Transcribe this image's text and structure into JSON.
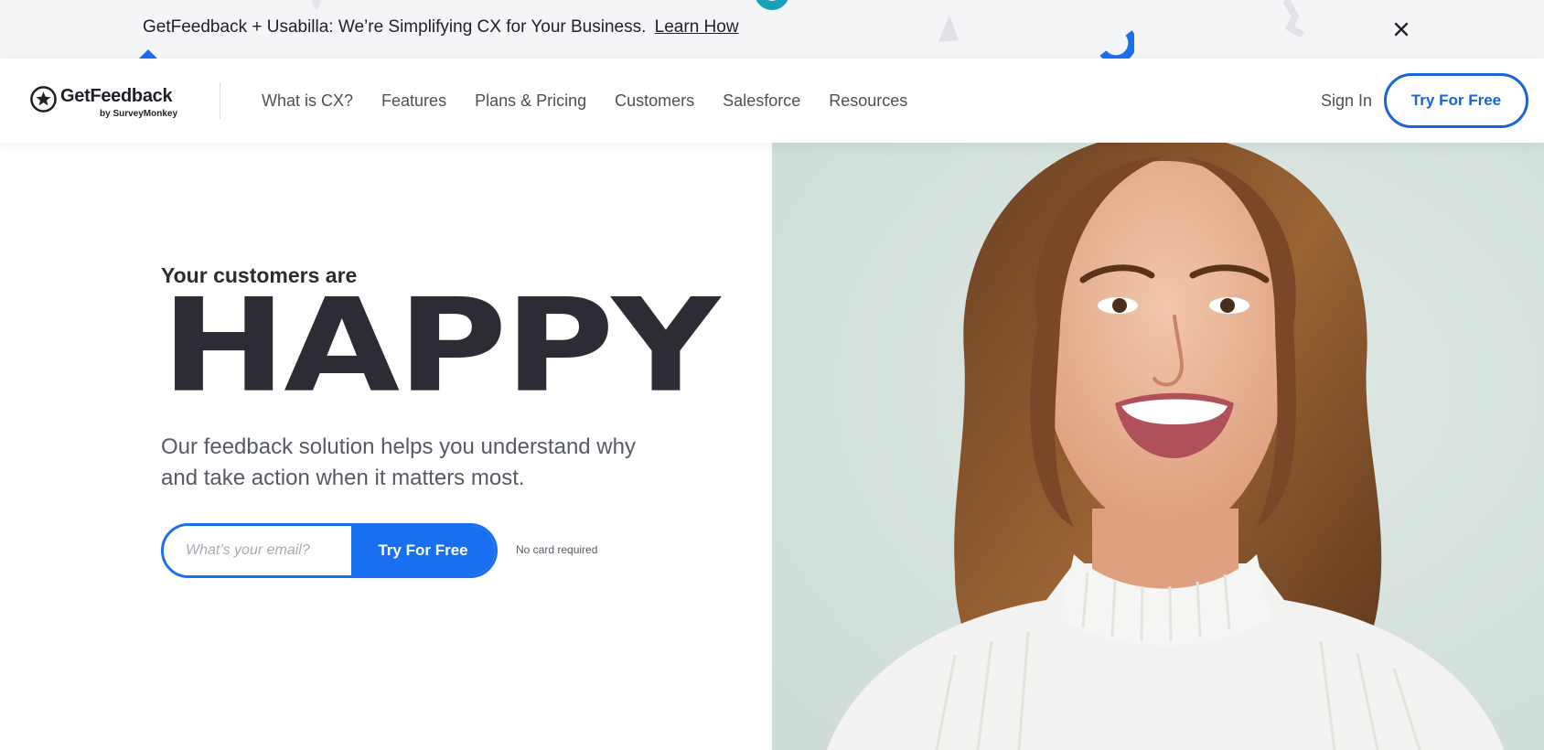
{
  "banner": {
    "text": "GetFeedback + Usabilla: We’re Simplifying CX for Your Business.",
    "link": "Learn How"
  },
  "header": {
    "logo": {
      "name": "GetFeedback",
      "sub": "by SurveyMonkey"
    },
    "nav": [
      "What is CX?",
      "Features",
      "Plans & Pricing",
      "Customers",
      "Salesforce",
      "Resources"
    ],
    "sign_in": "Sign In",
    "cta": "Try For Free"
  },
  "hero": {
    "eyebrow": "Your customers are",
    "headline": "HAPPY",
    "subtext": "Our feedback solution helps you understand why and take action when it matters most.",
    "email_placeholder": "What’s your email?",
    "cta": "Try For Free",
    "note": "No card required"
  },
  "colors": {
    "brand_blue": "#1a6ef0",
    "outline_blue": "#1a63d6",
    "text_dark": "#2b2c34",
    "photo_background": "#d6e2de",
    "banner_background": "#f4f5f7"
  },
  "icons": [
    "close-icon",
    "getfeedback-star-logo-icon"
  ]
}
